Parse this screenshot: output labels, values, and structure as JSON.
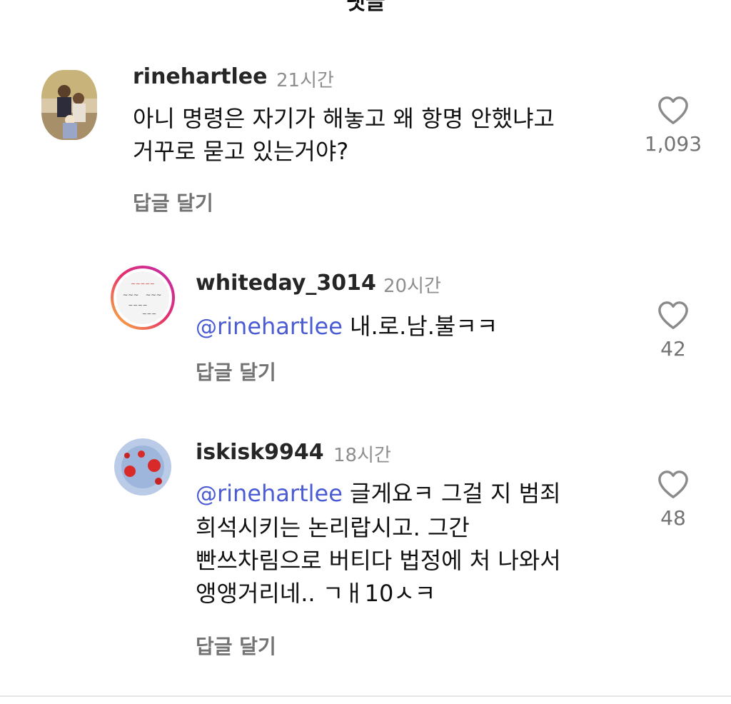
{
  "header": {
    "title": "댓글"
  },
  "comments": [
    {
      "username": "rinehartlee",
      "time": "21시간",
      "mention": "",
      "text_line1": "아니 명령은 자기가 해놓고 왜 항명 안했냐고",
      "text_line2": "거꾸로 묻고 있는거야?",
      "likes": "1,093",
      "reply_label": "답글 달기"
    },
    {
      "username": "whiteday_3014",
      "time": "20시간",
      "mention": "rinehartlee",
      "text": " 내.로.남.불ㅋㅋ",
      "likes": "42",
      "reply_label": "답글 달기"
    },
    {
      "username": "iskisk9944",
      "time": "18시간",
      "mention": "rinehartlee",
      "text_line1": " 글게요ㅋ 그걸 지 범죄",
      "text_line2": "희석시키는 논리랍시고. 그간",
      "text_line3": "빤쓰차림으로 버티다 법정에 처 나와서",
      "text_line4": "앵앵거리네.. ㄱㅐ10ㅅㅋ",
      "likes": "48",
      "reply_label": "답글 달기"
    }
  ],
  "icons": {
    "heart": "heart-outline-icon",
    "mention": "threads-at-icon"
  },
  "colors": {
    "mention": "#4a5bd4",
    "muted": "#737373",
    "timestamp": "#8e8e8e"
  }
}
